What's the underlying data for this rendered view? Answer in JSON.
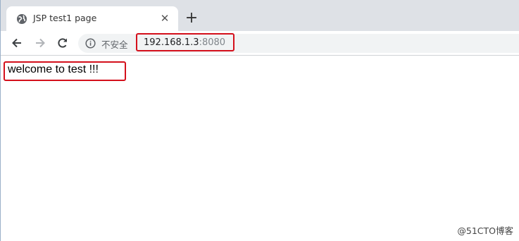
{
  "tab": {
    "title": "JSP test1 page",
    "favicon": "globe-icon",
    "close_glyph": "✕",
    "new_tab_glyph": "+"
  },
  "toolbar": {
    "back_icon": "back-arrow-icon",
    "forward_icon": "forward-arrow-icon",
    "reload_icon": "reload-icon"
  },
  "omnibox": {
    "security_icon": "info-icon",
    "security_label": "不安全",
    "url_host": "192.168.1.3",
    "url_port": ":8080"
  },
  "page": {
    "body_text": "welcome to test !!!"
  },
  "watermark": "@51CTO博客",
  "colors": {
    "annotation_red": "#d4101c",
    "tabstrip_bg": "#dee1e6",
    "omnibox_bg": "#f1f3f4"
  }
}
